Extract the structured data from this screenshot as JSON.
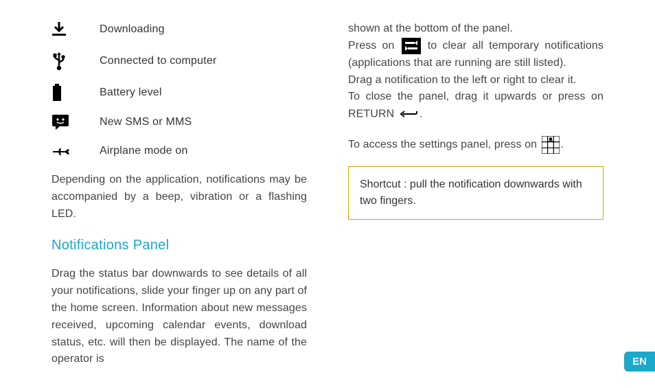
{
  "icons": [
    {
      "name": "download-icon",
      "label": "Downloading"
    },
    {
      "name": "usb-icon",
      "label": "Connected to computer"
    },
    {
      "name": "battery-icon",
      "label": "Battery level"
    },
    {
      "name": "sms-icon",
      "label": "New SMS or MMS"
    },
    {
      "name": "airplane-icon",
      "label": "Airplane mode on"
    }
  ],
  "left": {
    "beep_para": "Depending on the application, notifications may be accompanied by a beep, vibration or a flashing LED.",
    "heading": "Notifications Panel",
    "drag_para": "Drag the status bar downwards to see details of all your notifications, slide your finger up on any part of the home screen. Information about new messages received, upcoming calendar events, download status, etc. will then be displayed. The name of the operator is"
  },
  "right": {
    "line1": "shown at the bottom of the panel.",
    "line2a": "Press on ",
    "line2b": " to clear all temporary notifications (applications that are running are still listed).",
    "line3": "Drag a notification to the left or right to clear it.",
    "line4a": "To close the panel, drag it upwards or press on RETURN",
    "line4b": ".",
    "line5a": "To access the settings panel, press on ",
    "line5b": ".",
    "shortcut": "Shortcut : pull the notification downwards with two fingers."
  },
  "lang": "EN"
}
